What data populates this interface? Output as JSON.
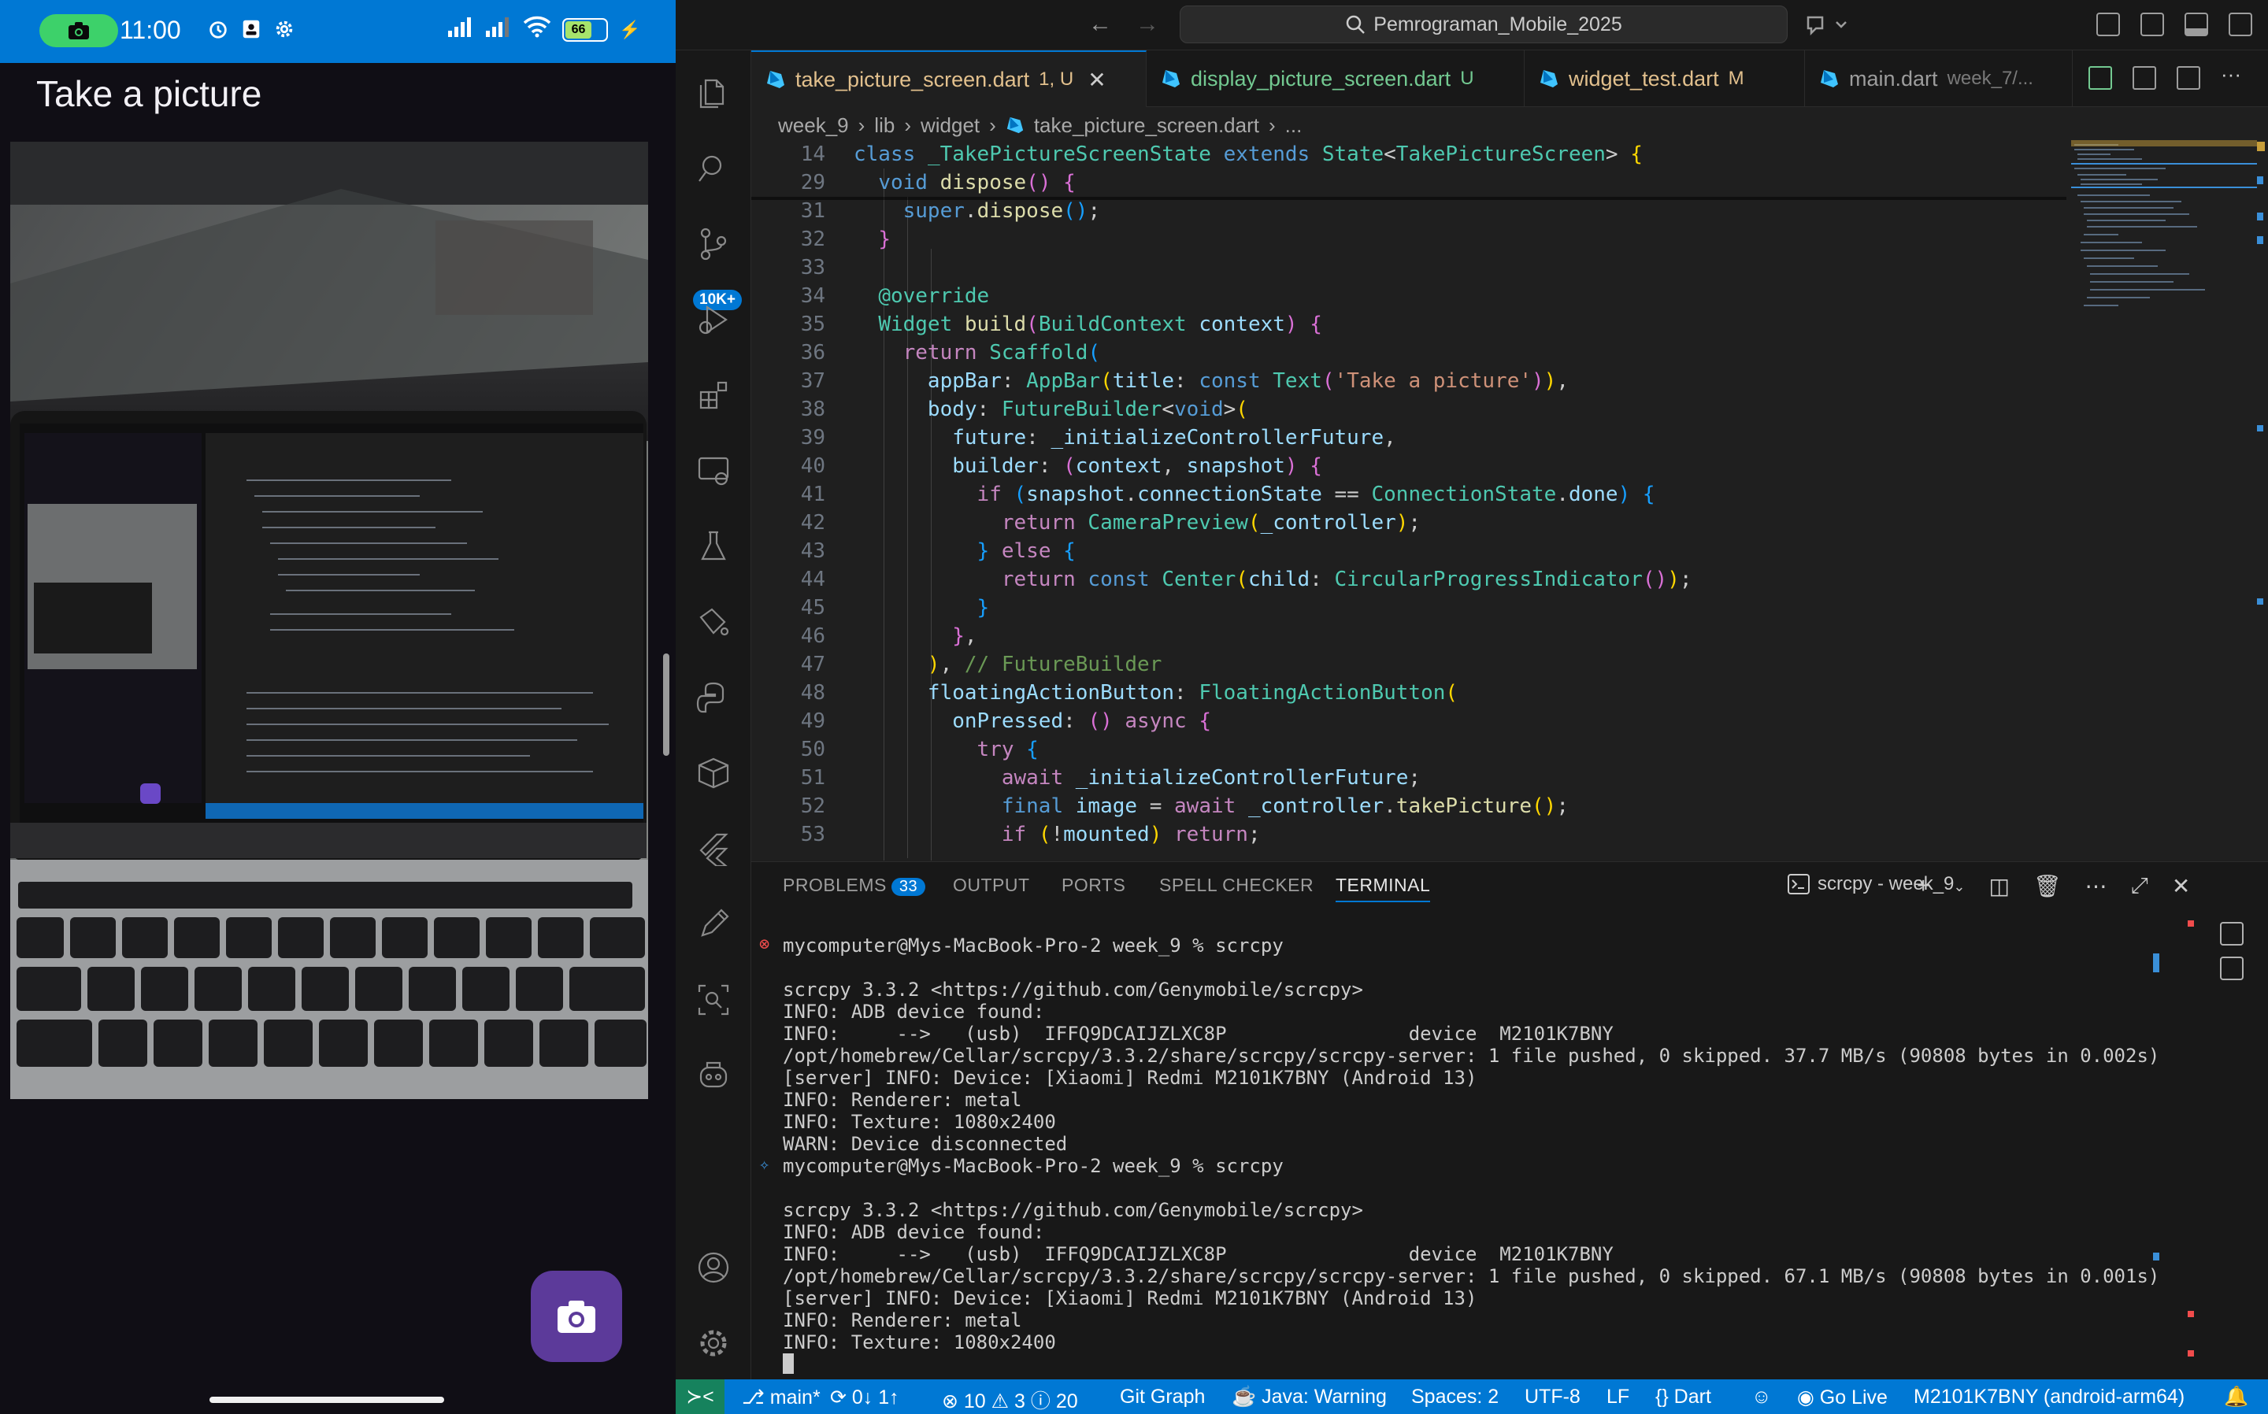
{
  "phone": {
    "status_time": "11:00",
    "battery_level": "66",
    "appbar_title": "Take a picture",
    "fab_icon": "camera-icon"
  },
  "vscode": {
    "command_center": "Pemrograman_Mobile_2025",
    "tabs": [
      {
        "label": "take_picture_screen.dart",
        "mark": "1, U"
      },
      {
        "label": "display_picture_screen.dart",
        "mark": "U"
      },
      {
        "label": "widget_test.dart",
        "mark": "M"
      },
      {
        "label": "main.dart",
        "mark": "week_7/..."
      }
    ],
    "breadcrumb": [
      "week_9",
      "lib",
      "widget",
      "take_picture_screen.dart",
      "..."
    ],
    "activity_badge": "10K+",
    "code_lines": [
      {
        "n": "14"
      },
      {
        "n": "29"
      },
      {
        "n": "31"
      },
      {
        "n": "32"
      },
      {
        "n": "33"
      },
      {
        "n": "34"
      },
      {
        "n": "35"
      },
      {
        "n": "36"
      },
      {
        "n": "37"
      },
      {
        "n": "38"
      },
      {
        "n": "39"
      },
      {
        "n": "40"
      },
      {
        "n": "41"
      },
      {
        "n": "42"
      },
      {
        "n": "43"
      },
      {
        "n": "44"
      },
      {
        "n": "45"
      },
      {
        "n": "46"
      },
      {
        "n": "47"
      },
      {
        "n": "48"
      },
      {
        "n": "49"
      },
      {
        "n": "50"
      },
      {
        "n": "51"
      },
      {
        "n": "52"
      },
      {
        "n": "53"
      }
    ],
    "panel": {
      "tabs": [
        "PROBLEMS",
        "OUTPUT",
        "PORTS",
        "SPELL CHECKER",
        "TERMINAL"
      ],
      "problems_count": "33",
      "terminal_name": "scrcpy - week_9"
    },
    "terminal_lines": [
      "mycomputer@Mys-MacBook-Pro-2 week_9 % scrcpy",
      "",
      "scrcpy 3.3.2 <https://github.com/Genymobile/scrcpy>",
      "INFO: ADB device found:",
      "INFO:     -->   (usb)  IFFQ9DCAIJZLXC8P                device  M2101K7BNY",
      "/opt/homebrew/Cellar/scrcpy/3.3.2/share/scrcpy/scrcpy-server: 1 file pushed, 0 skipped. 37.7 MB/s (90808 bytes in 0.002s)",
      "[server] INFO: Device: [Xiaomi] Redmi M2101K7BNY (Android 13)",
      "INFO: Renderer: metal",
      "INFO: Texture: 1080x2400",
      "WARN: Device disconnected",
      "mycomputer@Mys-MacBook-Pro-2 week_9 % scrcpy",
      "",
      "scrcpy 3.3.2 <https://github.com/Genymobile/scrcpy>",
      "INFO: ADB device found:",
      "INFO:     -->   (usb)  IFFQ9DCAIJZLXC8P                device  M2101K7BNY",
      "/opt/homebrew/Cellar/scrcpy/3.3.2/share/scrcpy/scrcpy-server: 1 file pushed, 0 skipped. 67.1 MB/s (90808 bytes in 0.001s)",
      "[server] INFO: Device: [Xiaomi] Redmi M2101K7BNY (Android 13)",
      "INFO: Renderer: metal",
      "INFO: Texture: 1080x2400"
    ],
    "statusbar": {
      "branch": "main*",
      "sync": "0↓ 1↑",
      "errors": "10",
      "warnings": "3",
      "infos": "20",
      "git_graph": "Git Graph",
      "java": "Java: Warning",
      "spaces": "Spaces: 2",
      "encoding": "UTF-8",
      "eol": "LF",
      "language": "Dart",
      "golive": "Go Live",
      "device": "M2101K7BNY (android-arm64)"
    }
  }
}
